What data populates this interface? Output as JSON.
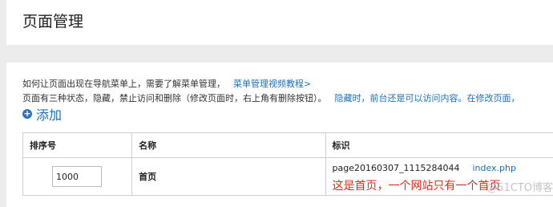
{
  "header": {
    "title": "页面管理"
  },
  "help": {
    "line1_text": "如何让页面出现在导航菜单上，需要了解菜单管理，",
    "line1_link": "菜单管理视频教程>",
    "line2_text": "页面有三种状态，隐藏，禁止访问和删除（修改页面时，右上角有删除按钮）。",
    "line2_warn": "隐藏时，前台还是可以访问内容。在修改页面，"
  },
  "actions": {
    "add_label": "添加"
  },
  "table": {
    "headers": {
      "order": "排序号",
      "name": "名称",
      "ident": "标识"
    },
    "rows": [
      {
        "order": "1000",
        "name": "首页",
        "ident": "page20160307_1115284044",
        "file": "index.php",
        "note": "这是首页，一个网站只有一个首页"
      }
    ]
  },
  "watermark": "@51CTO博客"
}
